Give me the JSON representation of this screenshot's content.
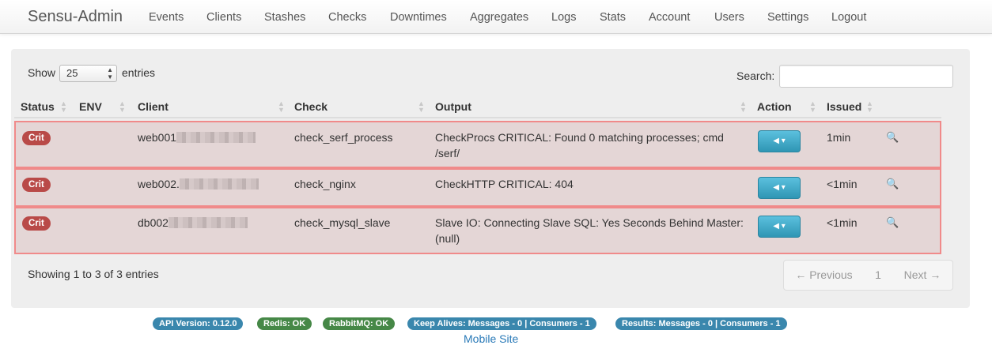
{
  "brand": "Sensu-Admin",
  "nav": [
    "Events",
    "Clients",
    "Stashes",
    "Checks",
    "Downtimes",
    "Aggregates",
    "Logs",
    "Stats",
    "Account",
    "Users",
    "Settings",
    "Logout"
  ],
  "length_menu": {
    "show_label": "Show",
    "value": "25",
    "entries_label": "entries"
  },
  "search": {
    "label": "Search:",
    "value": ""
  },
  "columns": [
    "Status",
    "ENV",
    "Client",
    "Check",
    "Output",
    "Action",
    "Issued"
  ],
  "rows": [
    {
      "status": "Crit",
      "env": "",
      "client": "web001",
      "check": "check_serf_process",
      "output": "CheckProcs CRITICAL: Found 0 matching processes; cmd /serf/",
      "issued": "1min"
    },
    {
      "status": "Crit",
      "env": "",
      "client": "web002.",
      "check": "check_nginx",
      "output": "CheckHTTP CRITICAL: 404",
      "issued": "<1min"
    },
    {
      "status": "Crit",
      "env": "",
      "client": "db002",
      "check": "check_mysql_slave",
      "output": "Slave IO: Connecting Slave SQL: Yes Seconds Behind Master: (null)",
      "issued": "<1min"
    }
  ],
  "info": "Showing 1 to 3 of 3 entries",
  "pagination": {
    "previous": "← Previous",
    "page": "1",
    "next": "Next →"
  },
  "footer": {
    "labels": [
      {
        "text": "API Version: 0.12.0",
        "color": "#3a87ad"
      },
      {
        "text": "Redis: OK",
        "color": "#468847"
      },
      {
        "text": "RabbitMQ: OK",
        "color": "#468847"
      },
      {
        "text": "Keep Alives: Messages - 0 | Consumers - 1",
        "color": "#3a87ad"
      },
      {
        "text": "Results: Messages - 0 | Consumers - 1",
        "color": "#3a87ad"
      }
    ],
    "mobile_link": "Mobile Site"
  },
  "colors": {
    "critical": "#b94a48",
    "info": "#3a87ad",
    "success": "#468847",
    "row_highlight": "#f08a8a"
  }
}
